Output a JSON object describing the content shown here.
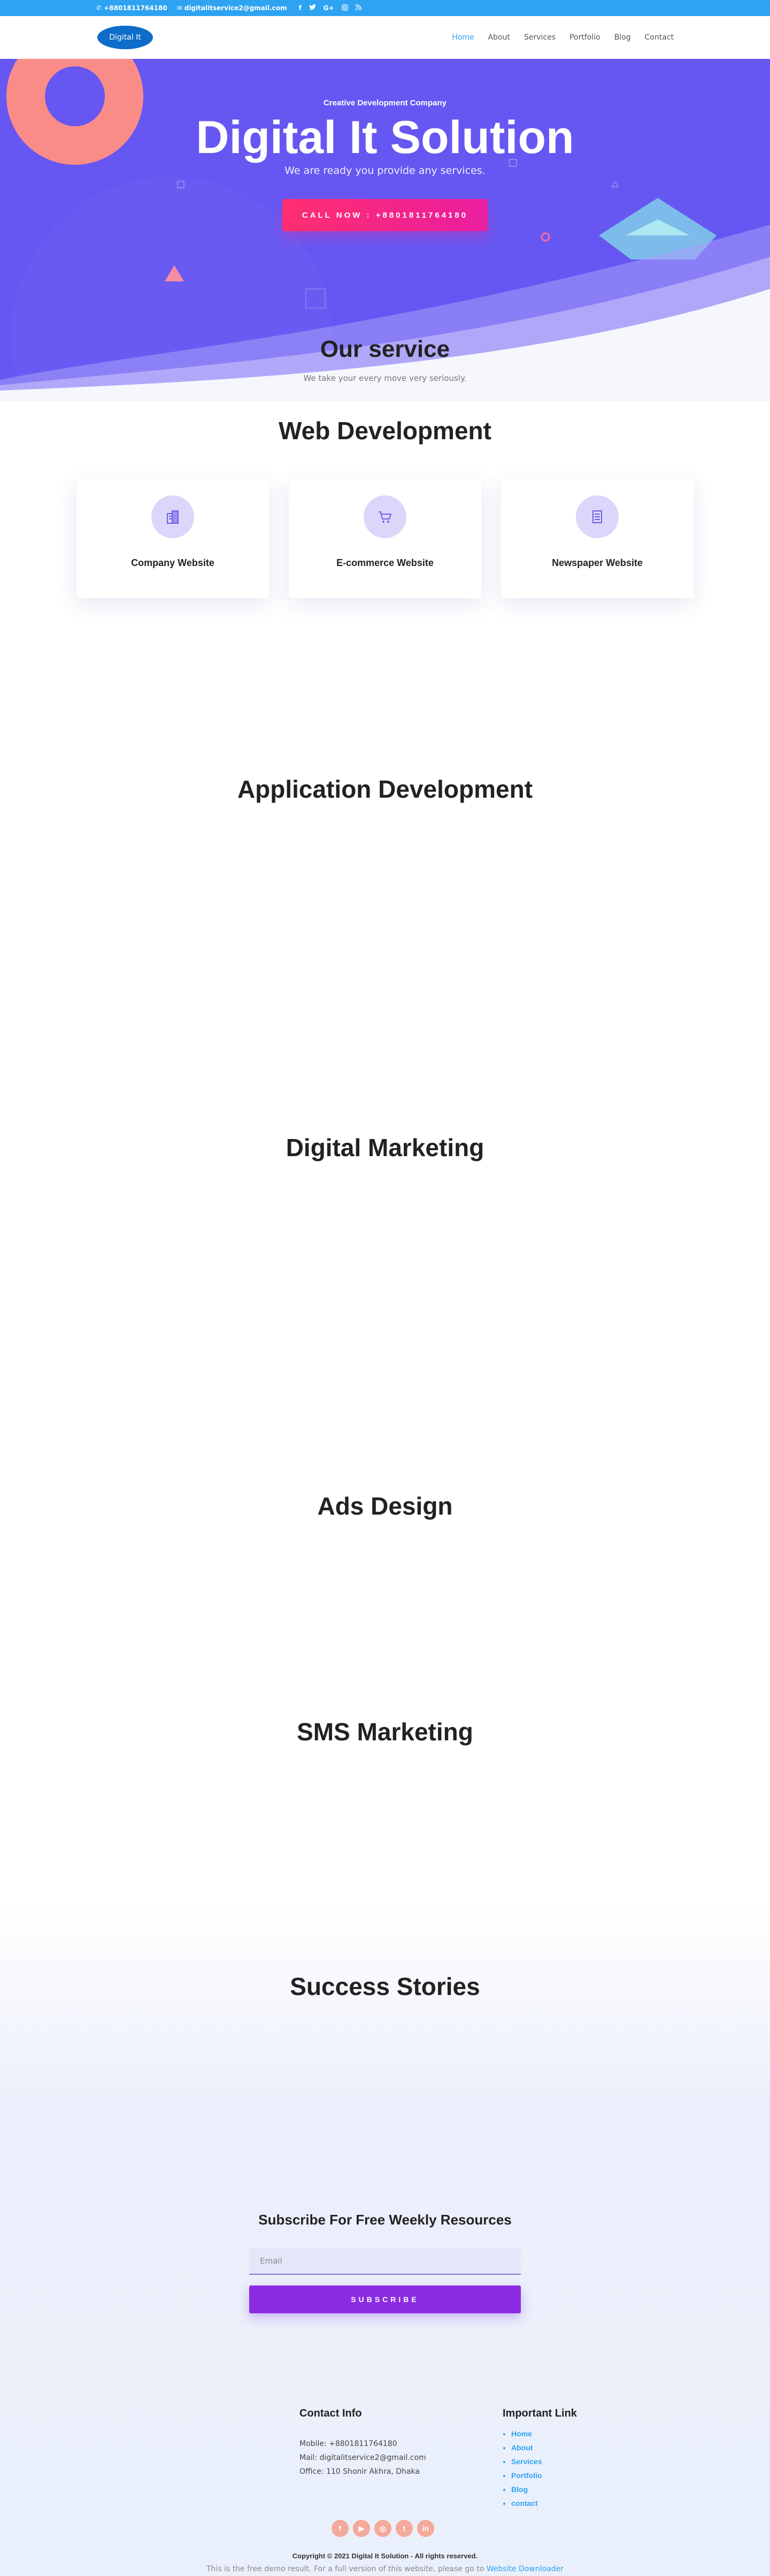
{
  "topbar": {
    "phone": "+8801811764180",
    "email": "digitalitservice2@gmail.com",
    "social_icons": [
      "facebook-icon",
      "twitter-icon",
      "google-plus-icon",
      "instagram-icon",
      "rss-icon"
    ]
  },
  "header": {
    "logo_text": "Digital It",
    "nav": [
      "Home",
      "About",
      "Services",
      "Portfolio",
      "Blog",
      "Contact"
    ],
    "active_nav": "Home"
  },
  "hero": {
    "kicker": "Creative Development Company",
    "title": "Digital It Solution",
    "subtitle": "We are ready you provide any services.",
    "cta_label": "CALL NOW : +8801811764180"
  },
  "service": {
    "title": "Our service",
    "subtitle": "We take your every move very seriously."
  },
  "sections": {
    "web": "Web Development",
    "app": "Application Development",
    "marketing": "Digital Marketing",
    "ads": "Ads Design",
    "sms": "SMS Marketing",
    "stories": "Success Stories"
  },
  "cards": [
    {
      "label": "Company Website",
      "icon": "building-icon"
    },
    {
      "label": "E-commerce Website",
      "icon": "cart-icon"
    },
    {
      "label": "Newspaper Website",
      "icon": "newspaper-icon"
    }
  ],
  "subscribe": {
    "title": "Subscribe For Free Weekly Resources",
    "email_placeholder": "Email",
    "button": "SUBSCRIBE"
  },
  "footer": {
    "contact_title": "Contact Info",
    "mobile": "Mobile: +8801811764180",
    "mail": "Mail: digitalitservice2@gmail.com",
    "office": "Office: 110 Shonir Akhra, Dhaka",
    "links_title": "Important Link",
    "links": [
      "Home",
      "About",
      "Services",
      "Portfolio",
      "Blog",
      "contact"
    ],
    "social_icons": [
      "facebook-icon",
      "youtube-icon",
      "instagram-icon",
      "twitter-icon",
      "linkedin-icon"
    ],
    "copyright": "Copyright © 2021 Digital It Solution - All rights reserved.",
    "demo_text": "This is the free demo result. For a full version of this website, please go to",
    "demo_link": "Website Downloader"
  },
  "colors": {
    "topbar": "#2ea3f2",
    "hero_bg": "#6657f2",
    "accent_pink": "#ff2e6e",
    "subscribe_button": "#8b2be2",
    "card_icon_bg": "#dcd6fb"
  }
}
